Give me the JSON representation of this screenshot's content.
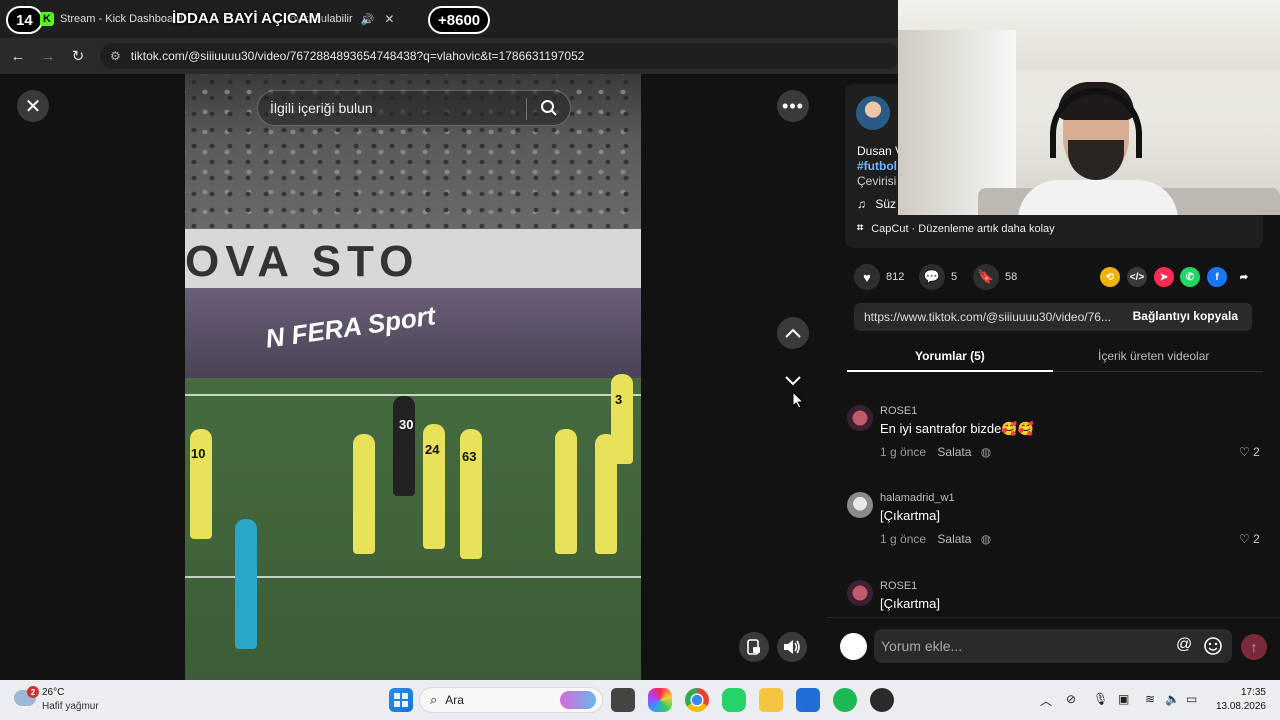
{
  "browser": {
    "tab_count_badge": "14",
    "tab_title": "Stream - Kick Dashboard",
    "tab2_partial": "ovic' bulabilir",
    "overlay_title": "İDDAA BAYİ AÇICAM",
    "plus_count": "+8600",
    "url": "tiktok.com/@siiiuuuu30/video/7672884893654748438?q=vlahovic&t=1786631197052"
  },
  "video": {
    "search_placeholder": "İlgili içeriği bulun",
    "banner_text": "OVA    STO",
    "adboard_text": "N FERA Sport",
    "jersey_numbers": [
      "10",
      "24",
      "63",
      "30",
      "3"
    ]
  },
  "post": {
    "author_line": "Dusan V",
    "hashtag_line": "#futbol",
    "translate_line": "Çevirisi",
    "sound_line": "Süz",
    "capcut_label": "CapCut · Düzenleme artık daha kolay",
    "likes": "812",
    "comments": "5",
    "saves": "58",
    "share_link": "https://www.tiktok.com/@siiiuuuu30/video/76...",
    "copy_link_label": "Bağlantıyı kopyala"
  },
  "tabs": {
    "comments_tab": "Yorumlar (5)",
    "creator_videos_tab": "İçerik üreten videolar"
  },
  "comments": [
    {
      "user": "ROSE1",
      "text": "En iyi santrafor bizde🥰🥰",
      "time": "1 g önce",
      "reply": "Salata",
      "likes": "2"
    },
    {
      "user": "halamadrid_w1",
      "text": "[Çıkartma]",
      "time": "1 g önce",
      "reply": "Salata",
      "likes": "2"
    },
    {
      "user": "ROSE1",
      "text": "[Çıkartma]",
      "time": "",
      "reply": "",
      "likes": ""
    }
  ],
  "comment_box": {
    "placeholder": "Yorum ekle..."
  },
  "taskbar": {
    "weather_badge": "2",
    "temperature": "26°C",
    "weather_desc": "Hafif yağmur",
    "search_label": "Ara",
    "time": "17:35",
    "date": "13.08.2026"
  },
  "colors": {
    "accent_link": "#6fb6ff",
    "kick_green": "#53fc18",
    "send_button": "#7a2a3a"
  }
}
